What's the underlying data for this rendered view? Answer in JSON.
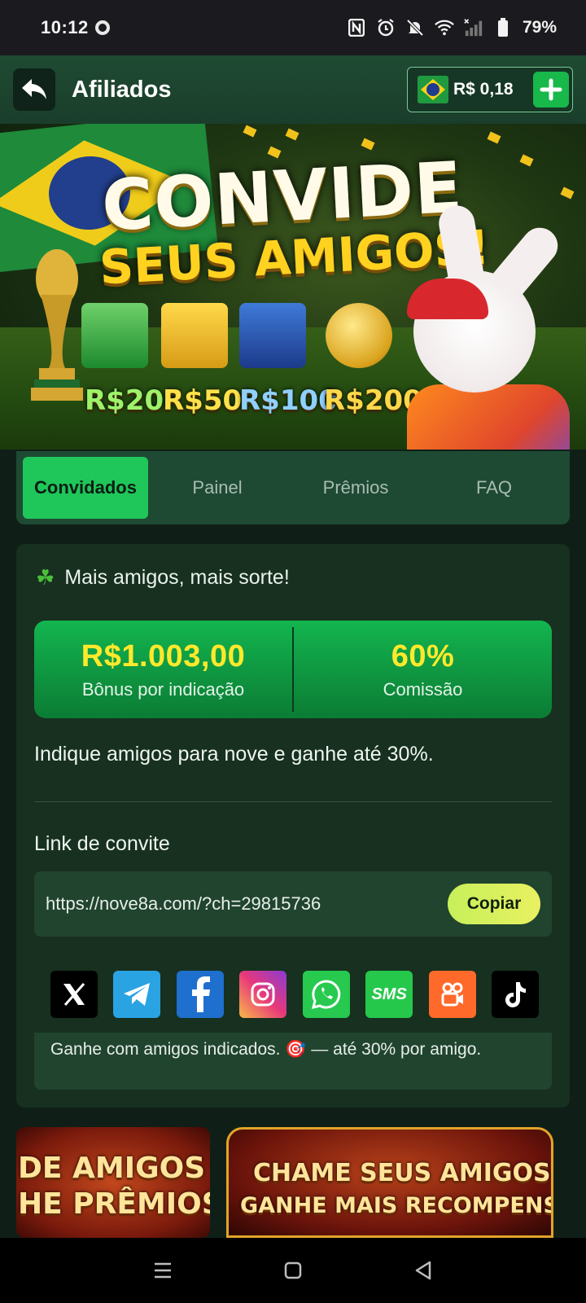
{
  "status_bar": {
    "time": "10:12",
    "battery_percent": "79%"
  },
  "header": {
    "title": "Afiliados",
    "balance": "R$ 0,18"
  },
  "hero": {
    "title_line1": "CONVIDE",
    "title_line2": "SEUS AMIGOS!",
    "prizes": [
      "R$20",
      "R$50",
      "R$100",
      "R$200"
    ]
  },
  "tabs": [
    {
      "label": "Convidados",
      "active": true
    },
    {
      "label": "Painel",
      "active": false
    },
    {
      "label": "Prêmios",
      "active": false
    },
    {
      "label": "FAQ",
      "active": false
    }
  ],
  "card": {
    "tagline": "Mais amigos, mais sorte!",
    "stats": [
      {
        "value": "R$1.003,00",
        "label": "Bônus por indicação"
      },
      {
        "value": "60%",
        "label": "Comissão"
      }
    ],
    "info_text": "Indique amigos para nove e ganhe até 30%.",
    "link_label": "Link de convite",
    "link_url": "https://nove8a.com/?ch=29815736",
    "copy_label": "Copiar",
    "socials": [
      "x-icon",
      "telegram-icon",
      "facebook-icon",
      "instagram-icon",
      "whatsapp-icon",
      "sms-icon",
      "kwai-icon",
      "tiktok-icon"
    ],
    "sms_text": "SMS",
    "footer_note": "Ganhe com amigos indicados. 🎯 — até 30% por amigo."
  },
  "promos": {
    "left_line1": "DE AMIGOS",
    "left_line2": "HE PRÊMIOS",
    "right_line1": "CHAME SEUS AMIGOS",
    "right_line2": "GANHE MAIS RECOMPENSAS"
  },
  "colors": {
    "accent_green": "#1fc65a",
    "stat_yellow": "#ffe92b",
    "background": "#0f1f18"
  }
}
